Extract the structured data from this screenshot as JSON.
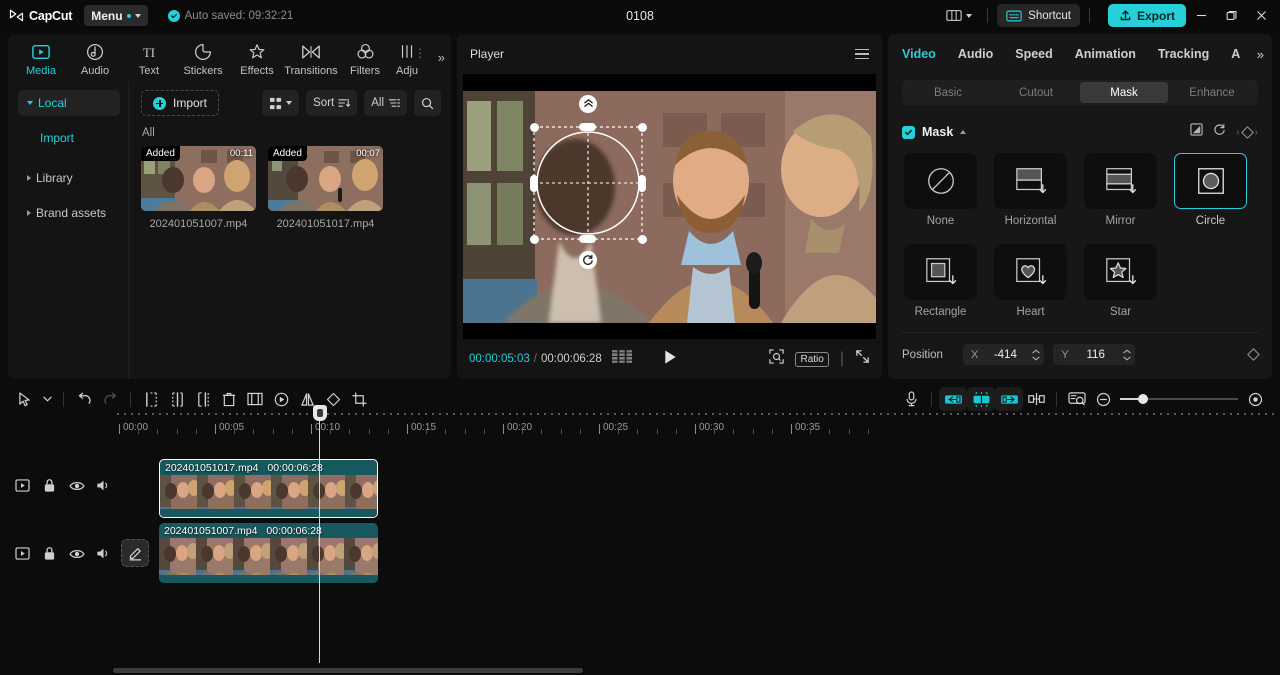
{
  "titlebar": {
    "brand": "CapCut",
    "menu_label": "Menu",
    "autosave_text": "Auto saved: 09:32:21",
    "project_title": "0108",
    "shortcut_label": "Shortcut",
    "export_label": "Export",
    "layout_icon": "layout-icon",
    "minimize_icon": "minimize-icon",
    "maximize_icon": "maximize-icon",
    "close_icon": "close-icon",
    "accent_color": "#25d0d8"
  },
  "media": {
    "tabs": [
      {
        "label": "Media",
        "icon": "media-icon",
        "active": true
      },
      {
        "label": "Audio",
        "icon": "audio-icon",
        "active": false
      },
      {
        "label": "Text",
        "icon": "text-icon",
        "active": false
      },
      {
        "label": "Stickers",
        "icon": "stickers-icon",
        "active": false
      },
      {
        "label": "Effects",
        "icon": "effects-icon",
        "active": false
      },
      {
        "label": "Transitions",
        "icon": "transitions-icon",
        "active": false
      },
      {
        "label": "Filters",
        "icon": "filters-icon",
        "active": false
      },
      {
        "label": "Adju",
        "icon": "adjust-icon",
        "active": false
      }
    ],
    "more_tabs": "»",
    "sidebar": [
      {
        "label": "Local",
        "selected": true
      },
      {
        "label": "Import",
        "sub": true
      },
      {
        "label": "Library",
        "selected": false
      },
      {
        "label": "Brand assets",
        "selected": false
      }
    ],
    "import_label": "Import",
    "grid_label": "grid-view-icon",
    "sort_label": "Sort",
    "filter_label": "All",
    "search_label": "search-icon",
    "section_label": "All",
    "items": [
      {
        "name": "202401051007.mp4",
        "duration": "00:11",
        "badge": "Added"
      },
      {
        "name": "202401051017.mp4",
        "duration": "00:07",
        "badge": "Added"
      }
    ]
  },
  "player": {
    "title": "Player",
    "menu_icon": "hamburger-icon",
    "current_time": "00:00:05:03",
    "separator": "/",
    "total_time": "00:00:06:28",
    "play_icon": "play-icon",
    "zoom_icon": "zoom-fit-icon",
    "ratio_label": "Ratio",
    "fullscreen_icon": "fullscreen-icon",
    "overlay": {
      "feather_icon": "feather-handle-icon",
      "rotate_icon": "rotate-handle-icon",
      "shape": "circle-mask-overlay"
    }
  },
  "properties": {
    "tabs": [
      {
        "label": "Video",
        "active": true
      },
      {
        "label": "Audio",
        "active": false
      },
      {
        "label": "Speed",
        "active": false
      },
      {
        "label": "Animation",
        "active": false
      },
      {
        "label": "Tracking",
        "active": false
      },
      {
        "label": "A",
        "active": false
      }
    ],
    "more_tabs": "»",
    "segments": [
      {
        "label": "Basic",
        "active": false
      },
      {
        "label": "Cutout",
        "active": false
      },
      {
        "label": "Mask",
        "active": true
      },
      {
        "label": "Enhance",
        "active": false
      }
    ],
    "mask_section": {
      "title": "Mask",
      "enabled": true,
      "invert_icon": "invert-mask-icon",
      "reset_icon": "reset-icon",
      "keyframe_icon": "keyframe-diamond-icon",
      "options": [
        {
          "label": "None",
          "icon": "none-mask-icon",
          "selected": false
        },
        {
          "label": "Horizontal",
          "icon": "horizontal-mask-icon",
          "selected": false
        },
        {
          "label": "Mirror",
          "icon": "mirror-mask-icon",
          "selected": false
        },
        {
          "label": "Circle",
          "icon": "circle-mask-icon",
          "selected": true
        },
        {
          "label": "Rectangle",
          "icon": "rectangle-mask-icon",
          "selected": false
        },
        {
          "label": "Heart",
          "icon": "heart-mask-icon",
          "selected": false
        },
        {
          "label": "Star",
          "icon": "star-mask-icon",
          "selected": false
        }
      ]
    },
    "position": {
      "label": "Position",
      "x_axis": "X",
      "x_value": "-414",
      "y_axis": "Y",
      "y_value": "116",
      "keyframe_icon": "keyframe-diamond-icon"
    }
  },
  "timeline": {
    "toolbar_left": [
      {
        "icon": "select-cursor-icon",
        "name": "select-tool"
      },
      {
        "icon": "chevron-down-icon",
        "name": "select-tool-dropdown"
      },
      {
        "icon": "undo-icon",
        "name": "undo-button"
      },
      {
        "icon": "redo-icon",
        "name": "redo-button"
      },
      {
        "icon": "split-icon",
        "name": "split-button"
      },
      {
        "icon": "trim-left-icon",
        "name": "trim-left-button"
      },
      {
        "icon": "trim-right-icon",
        "name": "trim-right-button"
      },
      {
        "icon": "delete-icon",
        "name": "delete-button"
      },
      {
        "icon": "freeze-icon",
        "name": "freeze-button"
      },
      {
        "icon": "reverse-icon",
        "name": "reverse-button"
      },
      {
        "icon": "mirror-icon",
        "name": "mirror-button"
      },
      {
        "icon": "rotate-icon",
        "name": "rotate-button"
      },
      {
        "icon": "crop-icon",
        "name": "crop-button"
      }
    ],
    "toolbar_right": [
      {
        "icon": "microphone-icon",
        "name": "record-voiceover-button"
      },
      {
        "icon": "clip-in-icon",
        "name": "clip-start-button"
      },
      {
        "icon": "clip-mid-icon",
        "name": "clip-middle-button"
      },
      {
        "icon": "clip-out-icon",
        "name": "clip-end-button"
      },
      {
        "icon": "split-audio-icon",
        "name": "detach-audio-button"
      },
      {
        "icon": "preview-icon",
        "name": "preview-button"
      },
      {
        "icon": "zoom-out-icon",
        "name": "timeline-zoom-out"
      },
      {
        "icon": "zoom-in-icon",
        "name": "timeline-zoom-in"
      }
    ],
    "ruler_labels": [
      "00:00",
      "00:05",
      "00:10",
      "00:15",
      "00:20",
      "00:25",
      "00:30",
      "00:35"
    ],
    "playhead_time": "00:05",
    "tracks": [
      {
        "controls": [
          "track-type-icon",
          "lock-icon",
          "visibility-icon",
          "volume-icon"
        ],
        "clip": {
          "name": "202401051017.mp4",
          "duration": "00:00:06:28",
          "selected": true
        }
      },
      {
        "controls": [
          "track-type-icon",
          "lock-icon",
          "visibility-icon",
          "volume-icon"
        ],
        "clip": {
          "name": "202401051007.mp4",
          "duration": "00:00:06:28",
          "selected": false
        }
      }
    ],
    "edit_fab_icon": "edit-pencil-icon"
  }
}
